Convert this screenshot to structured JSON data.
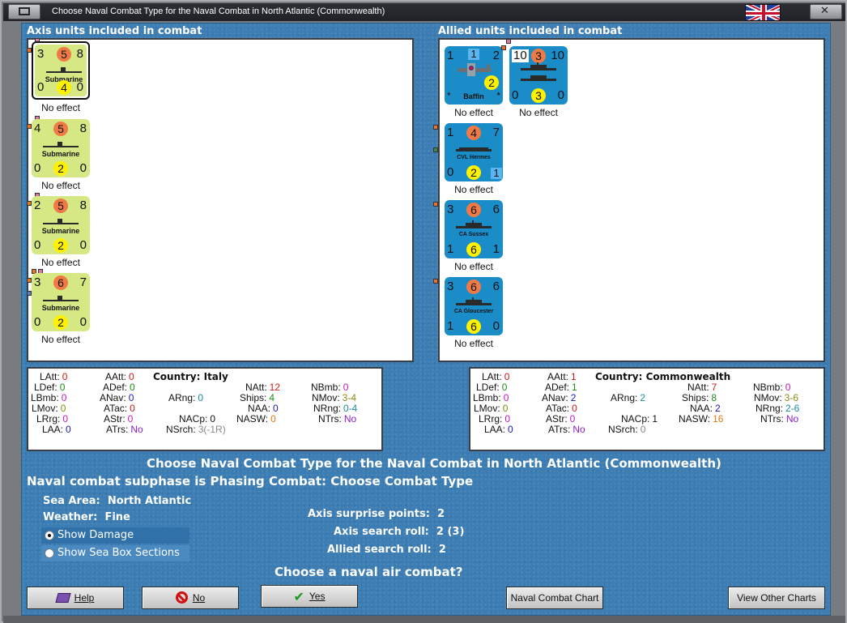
{
  "window": {
    "title": "Choose Naval Combat Type for the Naval Combat in North Atlantic (Commonwealth)"
  },
  "axis": {
    "label": "Axis units included in combat",
    "units": [
      {
        "tl": "3",
        "att": "5",
        "tr": "8",
        "name": "Submarine",
        "bl": "0",
        "def": "4",
        "br": "0",
        "effect": "No effect"
      },
      {
        "tl": "4",
        "att": "5",
        "tr": "8",
        "name": "Submarine",
        "bl": "0",
        "def": "2",
        "br": "0",
        "effect": "No effect"
      },
      {
        "tl": "2",
        "att": "5",
        "tr": "8",
        "name": "Submarine",
        "bl": "0",
        "def": "2",
        "br": "0",
        "effect": "No effect"
      },
      {
        "tl": "3",
        "att": "6",
        "tr": "7",
        "name": "Submarine",
        "bl": "0",
        "def": "2",
        "br": "0",
        "effect": "No effect"
      }
    ]
  },
  "allied": {
    "label": "Allied units included in combat",
    "units": [
      {
        "tl": "1",
        "box": "1",
        "tr": "2",
        "name": "Baffin",
        "def": "2",
        "star_l": "*",
        "star_r": "*",
        "effect": "No effect"
      },
      {
        "tl": "10",
        "att": "3",
        "tr": "10",
        "bl": "0",
        "def": "3",
        "br": "0",
        "effect": "No effect"
      },
      {
        "tl": "1",
        "att": "4",
        "tr": "7",
        "name": "CVL Hermes",
        "bl": "0",
        "def": "2",
        "box": "1",
        "effect": "No effect"
      },
      {
        "tl": "3",
        "att": "6",
        "tr": "6",
        "name": "CA Sussex",
        "bl": "1",
        "def": "6",
        "br": "1",
        "effect": "No effect"
      },
      {
        "tl": "3",
        "att": "6",
        "tr": "6",
        "name": "CA Gloucester",
        "bl": "1",
        "def": "6",
        "br": "0",
        "effect": "No effect"
      }
    ]
  },
  "axis_stats": {
    "country_label": "Country:",
    "country": "Italy",
    "LAtt": "0",
    "AAtt": "0",
    "LDef": "0",
    "ADef": "0",
    "LBmb": "0",
    "ANav": "0",
    "LMov": "0",
    "ATac": "0",
    "LRrg": "0",
    "AStr": "0",
    "LAA": "0",
    "ATrs": "No",
    "ARng": "0",
    "NAtt": "12",
    "NBmb": "0",
    "Ships": "4",
    "NMov": "3-4",
    "NAA": "0",
    "NRng": "0-4",
    "NASW": "0",
    "NTrs": "No",
    "NACp": "0",
    "NSrch": "3(-1R)"
  },
  "allied_stats": {
    "country_label": "Country:",
    "country": "Commonwealth",
    "LAtt": "0",
    "AAtt": "1",
    "LDef": "0",
    "ADef": "1",
    "LBmb": "0",
    "ANav": "2",
    "LMov": "0",
    "ATac": "0",
    "LRrg": "0",
    "AStr": "0",
    "LAA": "0",
    "ATrs": "No",
    "ARng": "2",
    "NAtt": "7",
    "NBmb": "0",
    "Ships": "8",
    "NMov": "3-6",
    "NAA": "2",
    "NRng": "2-6",
    "NASW": "16",
    "NTrs": "No",
    "NACp": "1",
    "NSrch": "0"
  },
  "heading": "Choose Naval Combat Type for the Naval Combat in North Atlantic (Commonwealth)",
  "subphase": "Naval combat subphase is Phasing Combat: Choose Combat Type",
  "info": {
    "sea_area_label": "Sea Area:",
    "sea_area": "North Atlantic",
    "weather_label": "Weather:",
    "weather": "Fine",
    "axis_surprise_label": "Axis surprise points:",
    "axis_surprise": "2",
    "axis_search_label": "Axis search roll:",
    "axis_search": "2 (3)",
    "allied_search_label": "Allied search roll:",
    "allied_search": "2"
  },
  "options": {
    "show_damage": "Show Damage",
    "show_sea_box": "Show Sea Box Sections"
  },
  "question": "Choose a naval air combat?",
  "buttons": {
    "help": "Help",
    "no": "No",
    "yes": "Yes",
    "naval_chart": "Naval Combat Chart",
    "other_charts": "View Other Charts"
  },
  "colors": {
    "background": "#3c7db3",
    "axis_counter": "#d5e884",
    "allied_counter": "#1a8dc9",
    "attack_circle": "#ef7a45",
    "defense_circle": "#fff200",
    "stat_red": "#d01818",
    "stat_green": "#1e8a1e",
    "stat_magenta": "#c018c0",
    "stat_teal": "#1e8a9a",
    "stat_blue": "#1818c0",
    "stat_orange": "#e07a10",
    "stat_purple": "#8a1ec8",
    "stat_gray": "#888888",
    "stat_olive": "#8a8a10"
  }
}
